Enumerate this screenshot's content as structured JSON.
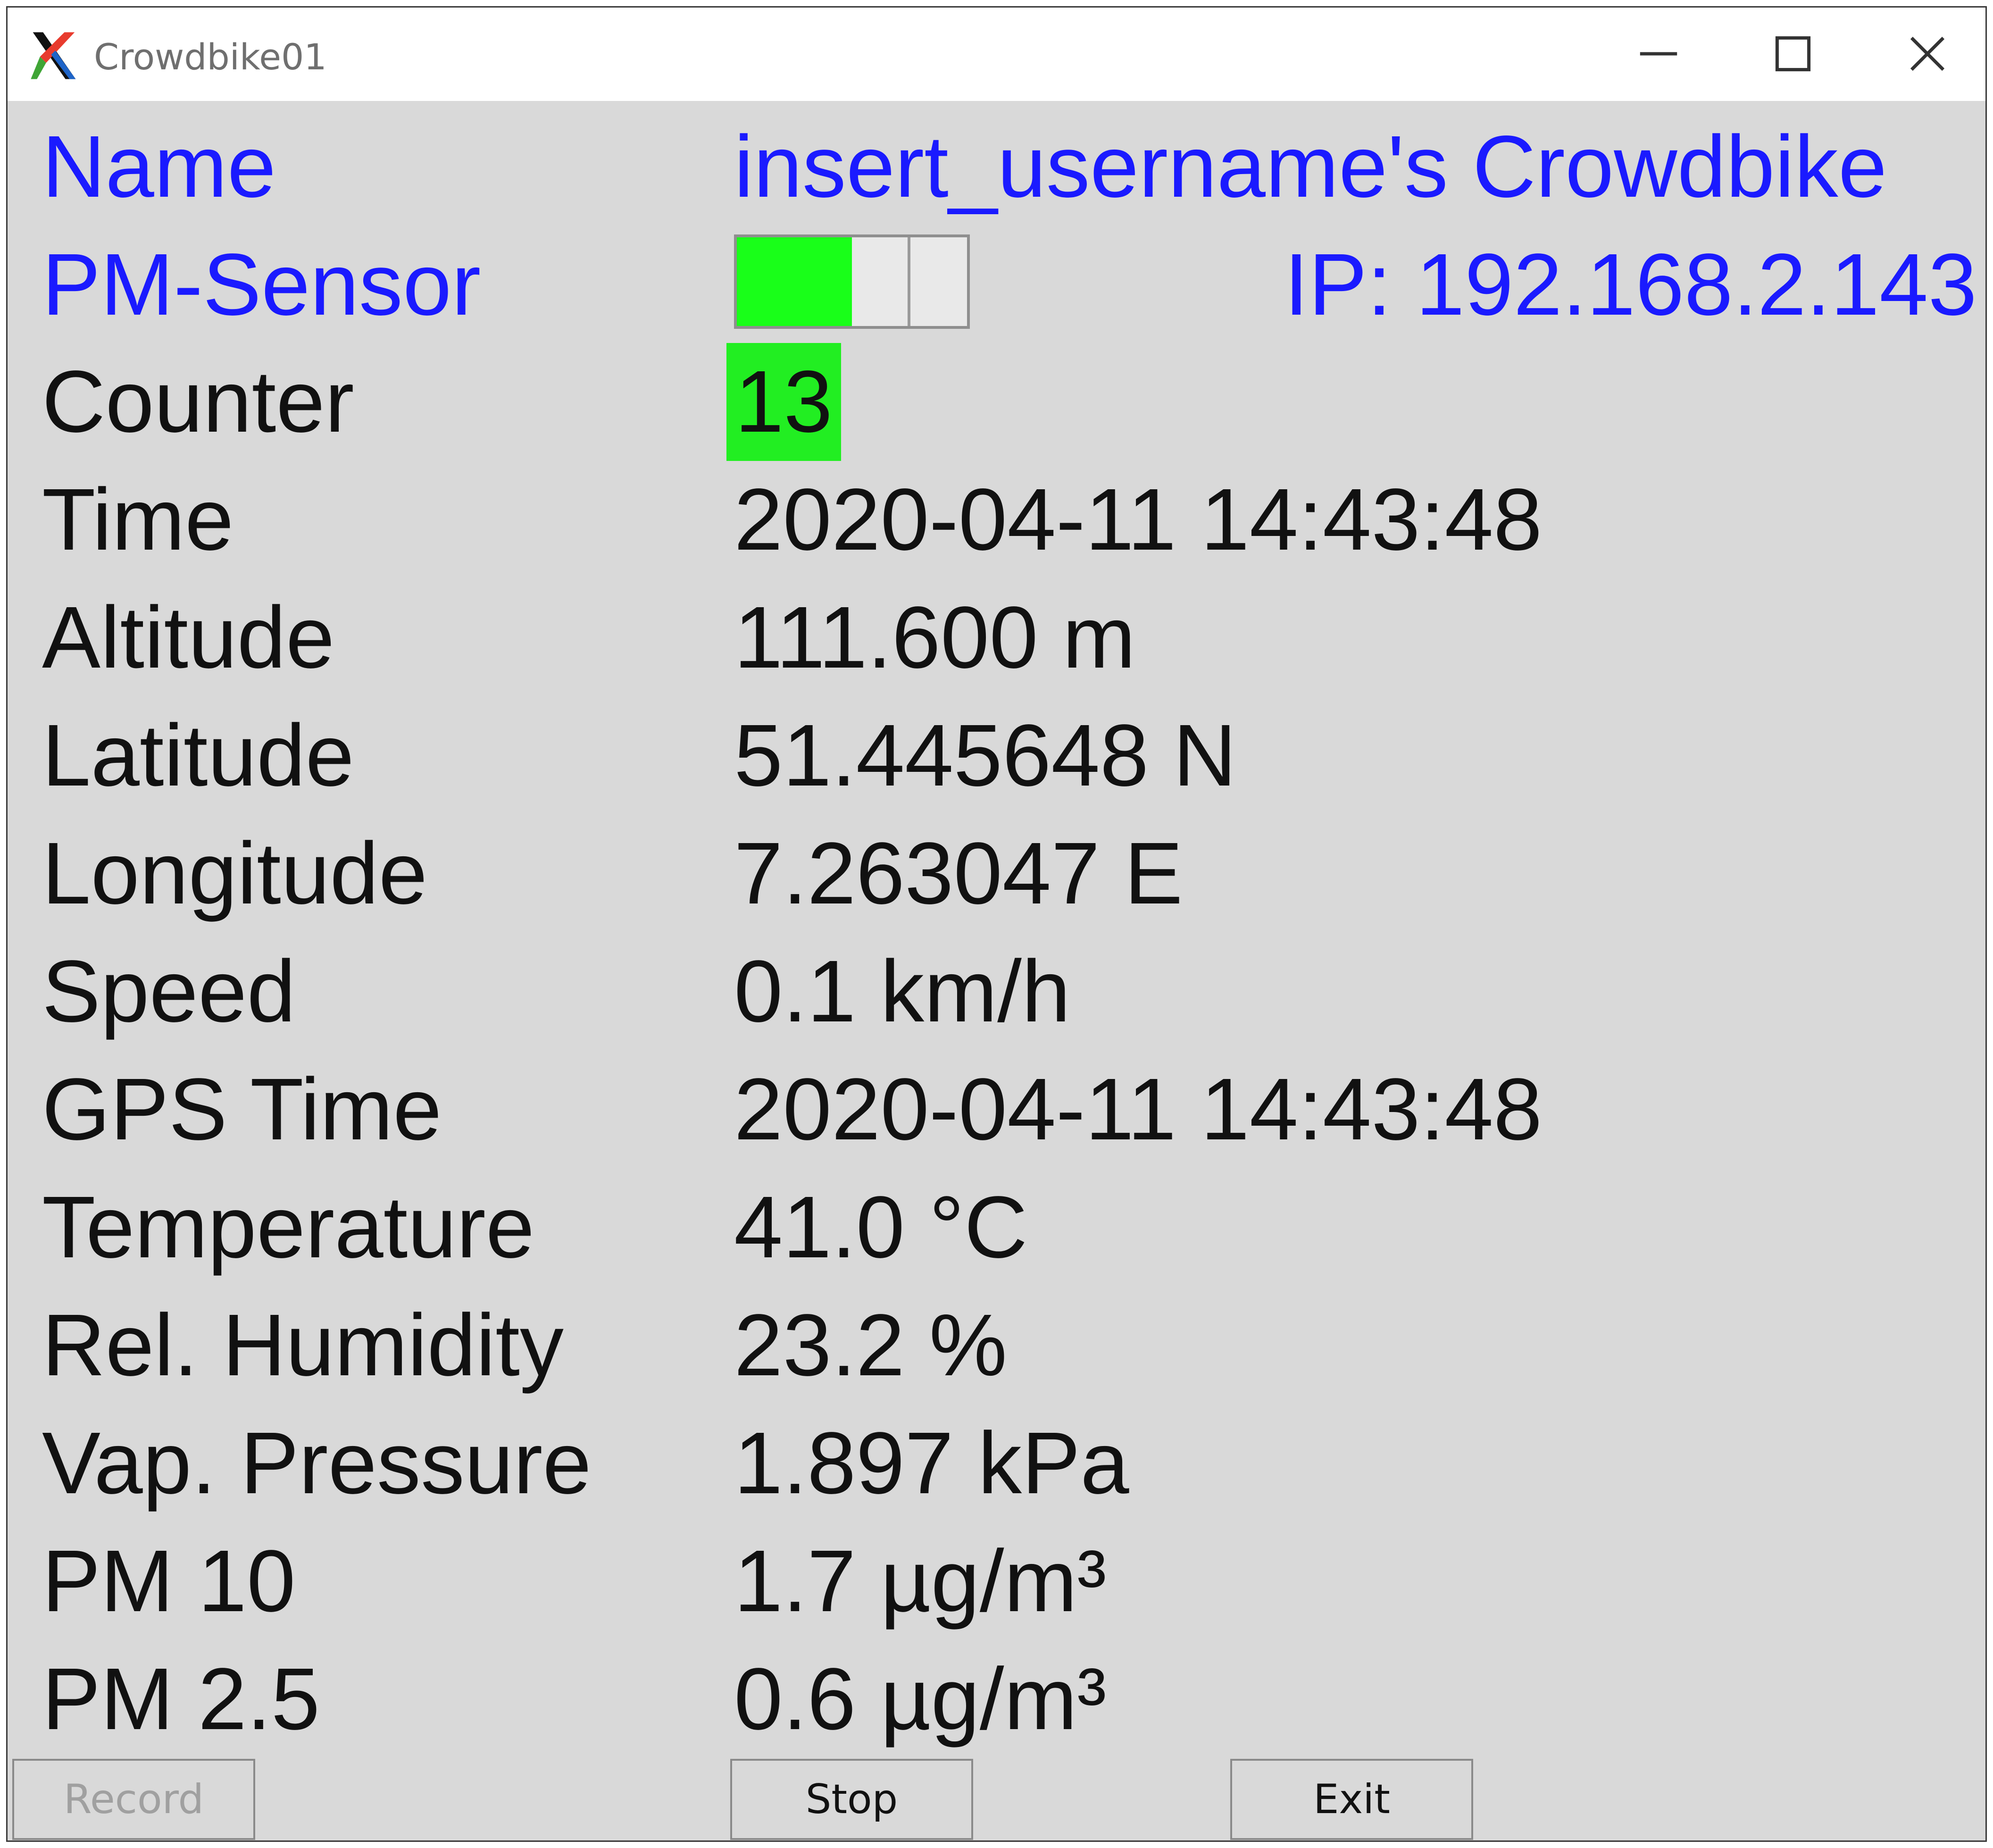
{
  "window": {
    "title": "Crowdbike01",
    "app_icon": "x-logo-icon",
    "controls": [
      "minimize-icon",
      "maximize-icon",
      "close-icon"
    ]
  },
  "header": {
    "name_label": "Name",
    "name_value": "insert_username's Crowdbike",
    "sensor_label": "PM-Sensor",
    "sensor_level": 0.5,
    "sensor_color": "#19ff19",
    "ip_text": "IP: 192.168.2.143"
  },
  "counter": {
    "label": "Counter",
    "value": "13",
    "color": "#22ee22"
  },
  "readings": [
    {
      "label": "Time",
      "value": "2020-04-11 14:43:48"
    },
    {
      "label": "Altitude",
      "value": "111.600 m"
    },
    {
      "label": "Latitude",
      "value": "51.445648 N"
    },
    {
      "label": "Longitude",
      "value": "7.263047 E"
    },
    {
      "label": "Speed",
      "value": "0.1 km/h"
    },
    {
      "label": "GPS Time",
      "value": "2020-04-11 14:43:48"
    },
    {
      "label": "Temperature",
      "value": "41.0 °C"
    },
    {
      "label": "Rel. Humidity",
      "value": "23.2 %"
    },
    {
      "label": "Vap. Pressure",
      "value": "1.897 kPa"
    },
    {
      "label": "PM 10",
      "value": "1.7 µg/m³"
    },
    {
      "label": "PM 2.5",
      "value": "0.6 µg/m³"
    }
  ],
  "buttons": {
    "record": "Record",
    "stop": "Stop",
    "exit": "Exit"
  },
  "colors": {
    "label_blue": "#1a1aff",
    "background": "#d9d9d9"
  }
}
